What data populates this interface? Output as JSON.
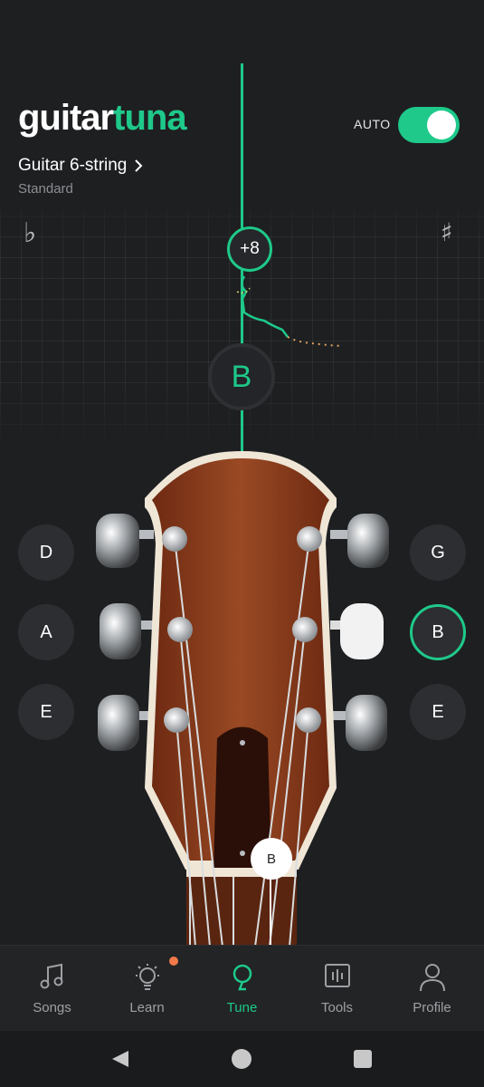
{
  "header": {
    "logo_part1": "guitar",
    "logo_part2": "tuna",
    "instrument": "Guitar 6-string",
    "tuning": "Standard",
    "auto_label": "AUTO",
    "auto_enabled": true
  },
  "tuner": {
    "flat_symbol": "♭",
    "sharp_symbol": "♯",
    "cents": "+8",
    "current_note": "B",
    "accent_color": "#1ec98a"
  },
  "pegs": {
    "left": [
      "D",
      "A",
      "E"
    ],
    "right": [
      "G",
      "B",
      "E"
    ],
    "active": "B",
    "selected_string_marker": "B"
  },
  "nav": {
    "items": [
      {
        "label": "Songs",
        "icon": "music-note-icon"
      },
      {
        "label": "Learn",
        "icon": "lightbulb-icon",
        "badge": true
      },
      {
        "label": "Tune",
        "icon": "tuner-icon",
        "active": true
      },
      {
        "label": "Tools",
        "icon": "tools-icon"
      },
      {
        "label": "Profile",
        "icon": "profile-icon"
      }
    ]
  },
  "system_nav": {
    "back": "back-icon",
    "home": "home-icon",
    "recents": "recents-icon"
  }
}
